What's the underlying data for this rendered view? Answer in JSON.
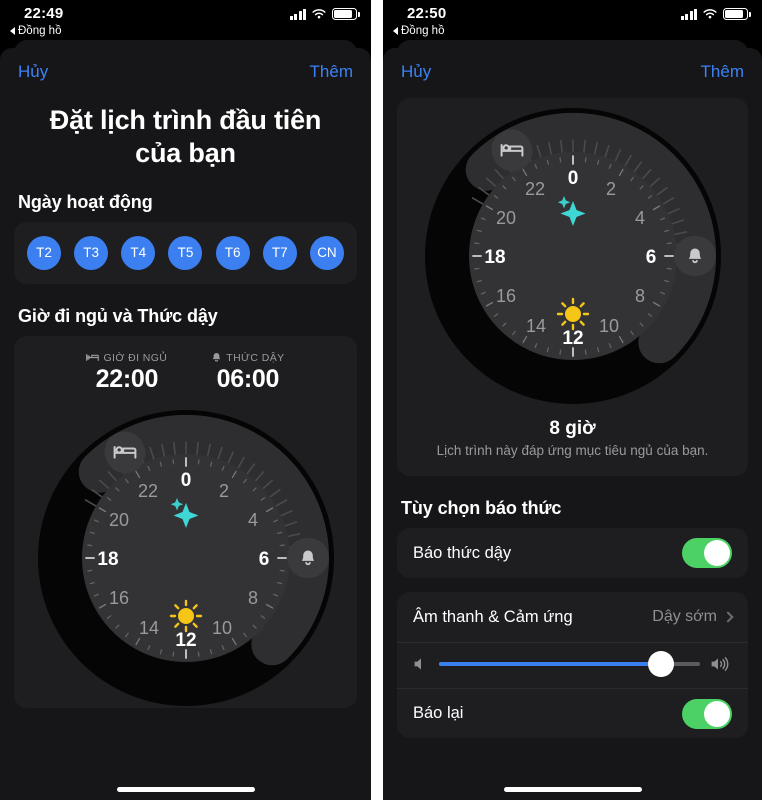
{
  "left": {
    "status": {
      "time": "22:49",
      "back_label": "Đồng hồ"
    },
    "nav": {
      "cancel": "Hủy",
      "add": "Thêm"
    },
    "title": "Đặt lịch trình đầu tiên của bạn",
    "sections": {
      "active_days": "Ngày hoạt động",
      "bed_wake": "Giờ đi ngủ và Thức dậy"
    },
    "days": [
      {
        "label": "T2",
        "selected": true
      },
      {
        "label": "T3",
        "selected": true
      },
      {
        "label": "T4",
        "selected": true
      },
      {
        "label": "T5",
        "selected": true
      },
      {
        "label": "T6",
        "selected": true
      },
      {
        "label": "T7",
        "selected": true
      },
      {
        "label": "CN",
        "selected": true
      }
    ],
    "schedule": {
      "bedtime_label": "GIỜ ĐI NGỦ",
      "bedtime_value": "22:00",
      "wake_label": "THỨC DẬY",
      "wake_value": "06:00"
    }
  },
  "right": {
    "status": {
      "time": "22:50",
      "back_label": "Đồng hồ"
    },
    "nav": {
      "cancel": "Hủy",
      "add": "Thêm"
    },
    "duration": {
      "value": "8 giờ",
      "note": "Lịch trình này đáp ứng mục tiêu ngủ của bạn."
    },
    "sections": {
      "alarm_options": "Tùy chọn báo thức"
    },
    "rows": {
      "wake_alarm_label": "Báo thức dậy",
      "wake_alarm_on": true,
      "sound_label": "Âm thanh & Cảm ứng",
      "sound_value": "Dậy sớm",
      "snooze_label": "Báo lại",
      "snooze_on": true
    },
    "volume": {
      "percent": 85
    }
  },
  "dial": {
    "hours": [
      "0",
      "2",
      "4",
      "6",
      "8",
      "10",
      "12",
      "14",
      "16",
      "18",
      "20",
      "22"
    ],
    "bold_hours": [
      "0",
      "6",
      "12",
      "18"
    ],
    "bedtime_icon": "bed-icon",
    "wake_icon": "bell-icon",
    "night_icon": "sparkle-icon",
    "day_icon": "sun-icon",
    "bedtime_hour": 22,
    "wake_hour": 6
  },
  "colors": {
    "accent_blue": "#3b7ff0",
    "toggle_green": "#4cd264",
    "sun_yellow": "#f5c518",
    "sparkle_teal": "#3fd6d6",
    "card_bg": "#1e1e20",
    "sheet_bg": "#161618"
  }
}
